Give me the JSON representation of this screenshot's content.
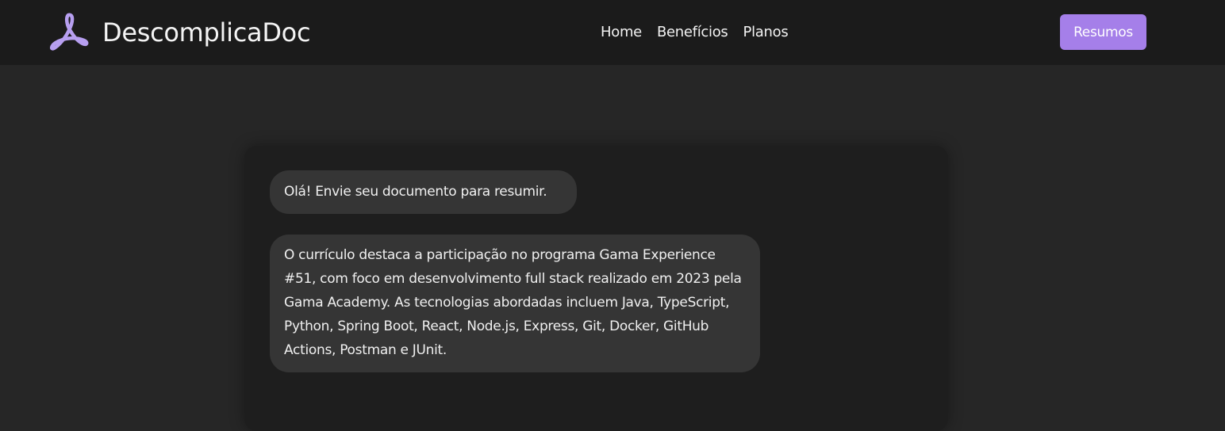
{
  "navbar": {
    "brand_name": "DescomplicaDoc",
    "logo_icon": "acrobat-pdf-icon",
    "links": [
      {
        "label": "Home"
      },
      {
        "label": "Benefícios"
      },
      {
        "label": "Planos"
      }
    ],
    "cta_label": "Resumos"
  },
  "chat": {
    "messages": [
      {
        "text": "Olá! Envie seu documento para resumir."
      },
      {
        "text": "O currículo destaca a participação no programa Gama Experience #51, com foco em desenvolvimento full stack realizado em 2023 pela Gama Academy. As tecnologias abordadas incluem Java, TypeScript, Python, Spring Boot, React, Node.js, Express, Git, Docker, GitHub Actions, Postman e JUnit."
      }
    ]
  },
  "colors": {
    "page_background": "#262626",
    "navbar_background": "#1b1b1b",
    "card_background": "#1e1e1e",
    "bubble_background": "#353535",
    "accent": "#a57fe9",
    "logo_color": "#b79ff0"
  }
}
